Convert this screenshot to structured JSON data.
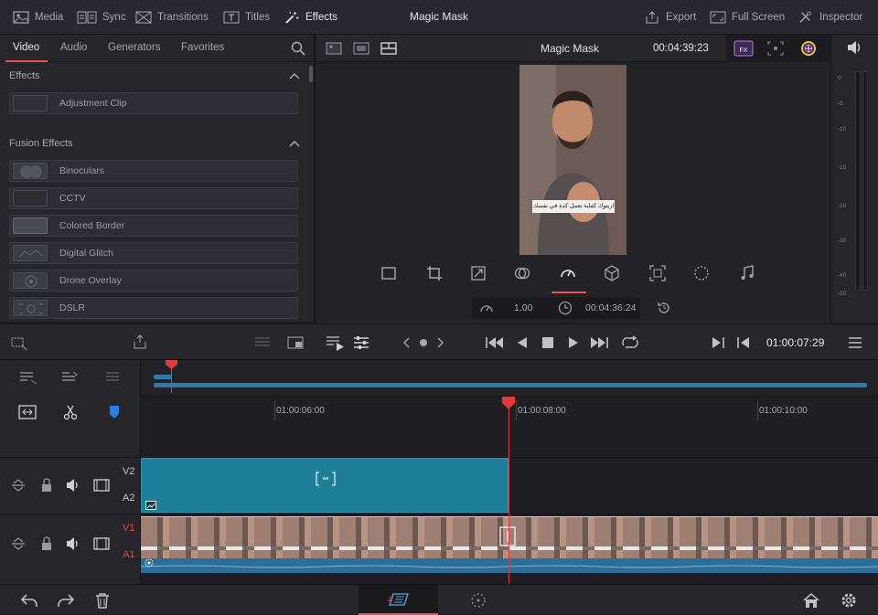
{
  "top_bar": {
    "items": [
      {
        "label": "Media",
        "icon": "media-icon"
      },
      {
        "label": "Sync",
        "icon": "sync-icon"
      },
      {
        "label": "Transitions",
        "icon": "transitions-icon"
      },
      {
        "label": "Titles",
        "icon": "titles-icon"
      },
      {
        "label": "Effects",
        "icon": "effects-wand-icon"
      }
    ],
    "title": "Magic Mask",
    "right_items": [
      {
        "label": "Export",
        "icon": "export-icon"
      },
      {
        "label": "Full Screen",
        "icon": "full-screen-icon"
      },
      {
        "label": "Inspector",
        "icon": "inspector-icon"
      }
    ]
  },
  "effects_panel": {
    "tabs": [
      "Video",
      "Audio",
      "Generators",
      "Favorites"
    ],
    "active_tab": "Video",
    "sections": [
      {
        "title": "Effects",
        "items": [
          "Adjustment Clip"
        ]
      },
      {
        "title": "Fusion Effects",
        "items": [
          "Binoculars",
          "CCTV",
          "Colored Border",
          "Digital Glitch",
          "Drone Overlay",
          "DSLR"
        ]
      }
    ]
  },
  "viewer": {
    "clip_name": "Magic Mask",
    "timecode": "00:04:39:23",
    "subtitle_text": "ازيتوك كفاية تعمل كدة في نفسك",
    "speed_value": "1.00",
    "speed_timecode": "00:04:36:24"
  },
  "audio_meter": {
    "labels": [
      "0",
      "-5",
      "-10",
      "-15",
      "-20",
      "-30",
      "-40",
      "-50"
    ]
  },
  "toolbar": {
    "timecode": "01:00:07:29"
  },
  "timeline": {
    "ruler_marks": [
      "01:00:06:00",
      "01:00:08:00",
      "01:00:10:00"
    ],
    "tracks": [
      {
        "video": "V2",
        "audio": "A2"
      },
      {
        "video": "V1",
        "audio": "A1"
      }
    ]
  },
  "colors": {
    "accent": "#e45454",
    "v2_clip": "#1f7f99",
    "audio_clip": "#2d6e98",
    "playhead": "#e13a3a"
  }
}
